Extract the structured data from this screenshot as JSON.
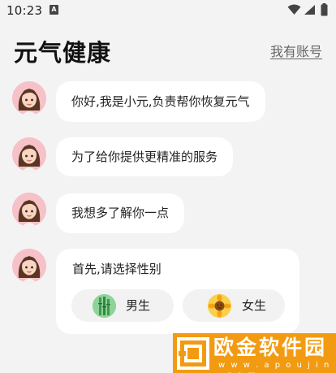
{
  "status_bar": {
    "time": "10:23",
    "notification_icon": "A"
  },
  "header": {
    "title": "元气健康",
    "account_link": "我有账号"
  },
  "chat": {
    "messages": [
      "你好,我是小元,负责帮你恢复元气",
      "为了给你提供更精准的服务",
      "我想多了解你一点",
      "首先,请选择性别"
    ],
    "gender_options": {
      "male": {
        "label": "男生",
        "icon": "bamboo-icon"
      },
      "female": {
        "label": "女生",
        "icon": "sunflower-icon"
      }
    }
  },
  "watermark": {
    "text": "欧金软件园",
    "url": "w w w . a p o u j i n . c o m"
  },
  "colors": {
    "background": "#f3f3f3",
    "bubble": "#ffffff",
    "watermark": "#f29b12"
  }
}
